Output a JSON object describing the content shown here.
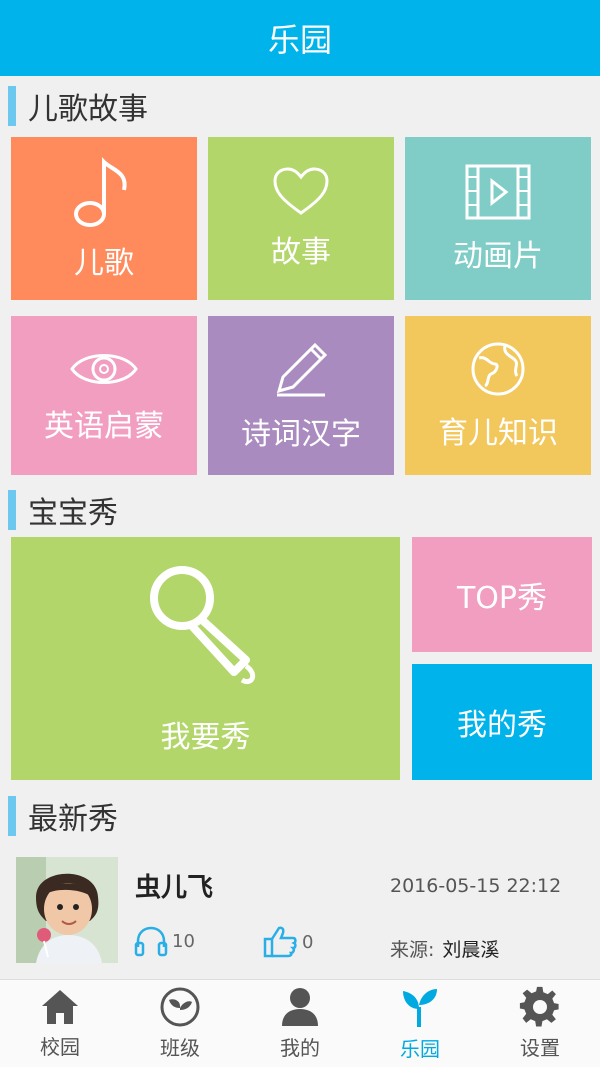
{
  "header": {
    "title": "乐园"
  },
  "sections": {
    "songs": "儿歌故事",
    "baby_show": "宝宝秀",
    "latest_show": "最新秀"
  },
  "tiles": {
    "song": {
      "label": "儿歌",
      "color": "#ff8a5c"
    },
    "story": {
      "label": "故事",
      "color": "#b2d66a"
    },
    "cartoon": {
      "label": "动画片",
      "color": "#7fcdc6"
    },
    "english": {
      "label": "英语启蒙",
      "color": "#f19ec1"
    },
    "poem": {
      "label": "诗词汉字",
      "color": "#a98bbf"
    },
    "parenting": {
      "label": "育儿知识",
      "color": "#f2c75c"
    }
  },
  "show": {
    "my_show_big": "我要秀",
    "top_show": "TOP秀",
    "mine": "我的秀"
  },
  "feed": {
    "name": "虫儿飞",
    "datetime": "2016-05-15 22:12",
    "listens": "10",
    "likes": "0",
    "source_label": "来源:",
    "source_name": "刘晨溪"
  },
  "tabs": [
    {
      "label": "校园",
      "icon": "home-icon"
    },
    {
      "label": "班级",
      "icon": "sprout-icon"
    },
    {
      "label": "我的",
      "icon": "person-icon"
    },
    {
      "label": "乐园",
      "icon": "plant-icon"
    },
    {
      "label": "设置",
      "icon": "gear-icon"
    }
  ],
  "colors": {
    "accent": "#00b3ea",
    "section_bar": "#6cc8ee",
    "show_green": "#b2d66a",
    "top_pink": "#f19ec1",
    "mine_blue": "#00b3ea"
  }
}
